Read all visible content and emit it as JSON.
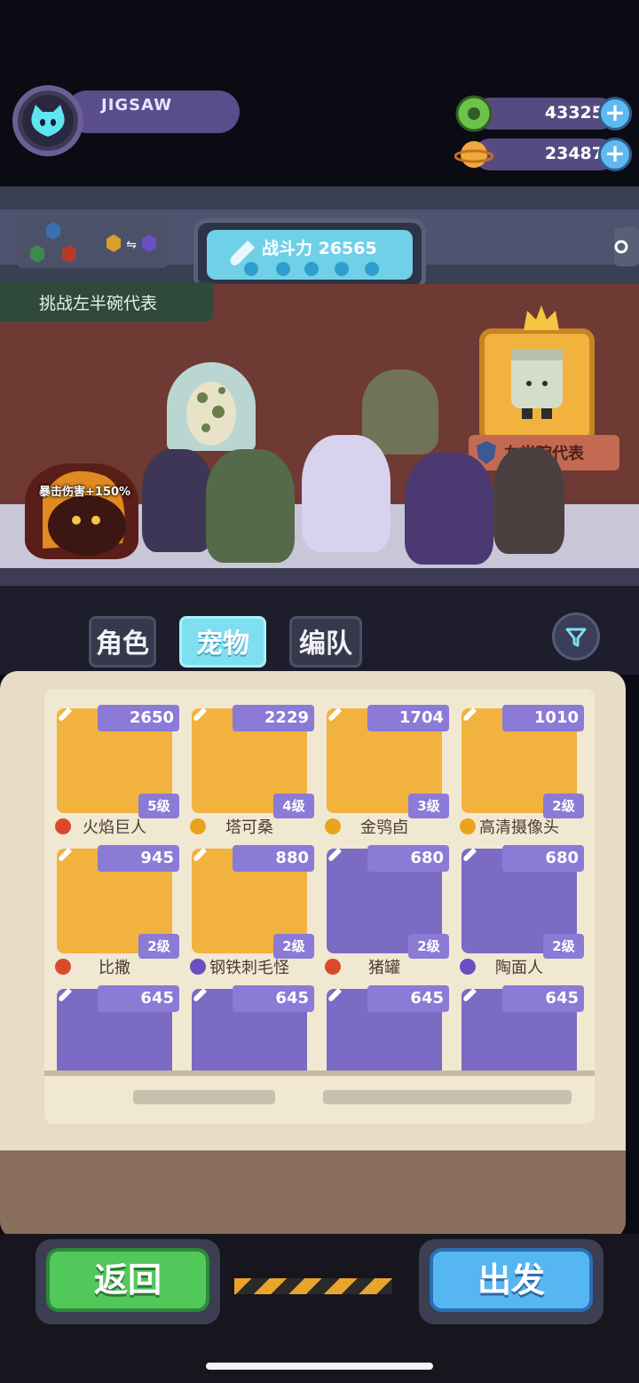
{
  "player": {
    "name": "JIGSAW"
  },
  "currencies": [
    {
      "icon": "green-donut-icon",
      "value": "43325",
      "color": "#6cc24a"
    },
    {
      "icon": "planet-coin-icon",
      "value": "23487",
      "color": "#f2a93b"
    }
  ],
  "power_panel": {
    "label": "战斗力 26565"
  },
  "challenge": {
    "label": "挑战左半碗代表"
  },
  "trophy": {
    "banner": "左半碗代表"
  },
  "stage": {
    "crit_buff": "暴击伤害+150%"
  },
  "tabs": [
    {
      "label": "角色",
      "active": false
    },
    {
      "label": "宠物",
      "active": true
    },
    {
      "label": "编队",
      "active": false
    }
  ],
  "pets": [
    {
      "power": "2650",
      "level": "5级",
      "name": "火焰巨人",
      "element": "fire",
      "bg": "gold"
    },
    {
      "power": "2229",
      "level": "4级",
      "name": "塔可桑",
      "element": "light",
      "bg": "gold"
    },
    {
      "power": "1704",
      "level": "3级",
      "name": "金鸮卣",
      "element": "light",
      "bg": "gold"
    },
    {
      "power": "1010",
      "level": "2级",
      "name": "高清摄像头",
      "element": "light",
      "bg": "gold"
    },
    {
      "power": "945",
      "level": "2级",
      "name": "比撒",
      "element": "fire",
      "bg": "gold"
    },
    {
      "power": "880",
      "level": "2级",
      "name": "钢铁刺毛怪",
      "element": "dark",
      "bg": "gold"
    },
    {
      "power": "680",
      "level": "2级",
      "name": "猪罐",
      "element": "fire",
      "bg": "purple"
    },
    {
      "power": "680",
      "level": "2级",
      "name": "陶面人",
      "element": "dark",
      "bg": "purple"
    },
    {
      "power": "645",
      "level": "",
      "name": "",
      "element": "",
      "bg": "purple"
    },
    {
      "power": "645",
      "level": "",
      "name": "",
      "element": "",
      "bg": "purple"
    },
    {
      "power": "645",
      "level": "",
      "name": "",
      "element": "",
      "bg": "purple"
    },
    {
      "power": "645",
      "level": "",
      "name": "",
      "element": "",
      "bg": "purple"
    }
  ],
  "buttons": {
    "back": "返回",
    "go": "出发"
  },
  "colors": {
    "accent_cyan": "#7ddff0",
    "accent_purple": "#8b7ad6",
    "gold_card": "#f2b23e",
    "green_button": "#52c85a",
    "blue_button": "#56b6f2"
  }
}
